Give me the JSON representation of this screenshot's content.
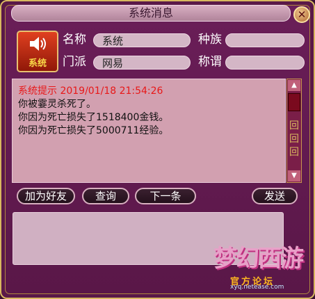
{
  "window": {
    "title": "系统消息",
    "close_glyph": "✕"
  },
  "avatar": {
    "icon": "speaker-icon",
    "label": "系统"
  },
  "fields": {
    "name_label": "名称",
    "name_value": "系统",
    "race_label": "种族",
    "race_value": "",
    "faction_label": "门派",
    "faction_value": "网易",
    "title_label": "称谓",
    "title_value": ""
  },
  "messages": {
    "header": "系统提示 2019/01/18 21:54:26",
    "lines": [
      "你被霎灵杀死了。",
      "你因为死亡损失了1518400金钱。",
      "你因为死亡损失了5000711经验。"
    ]
  },
  "buttons": {
    "add_friend": "加为好友",
    "query": "查询",
    "next": "下一条",
    "send": "发送"
  },
  "watermark": {
    "logo": "梦幻西游",
    "subtitle": "官方论坛",
    "url": "xyq.netease.com"
  },
  "colors": {
    "header_red": "#e81818",
    "frame_gold": "#d8b860",
    "window_purple": "#5a1848"
  }
}
